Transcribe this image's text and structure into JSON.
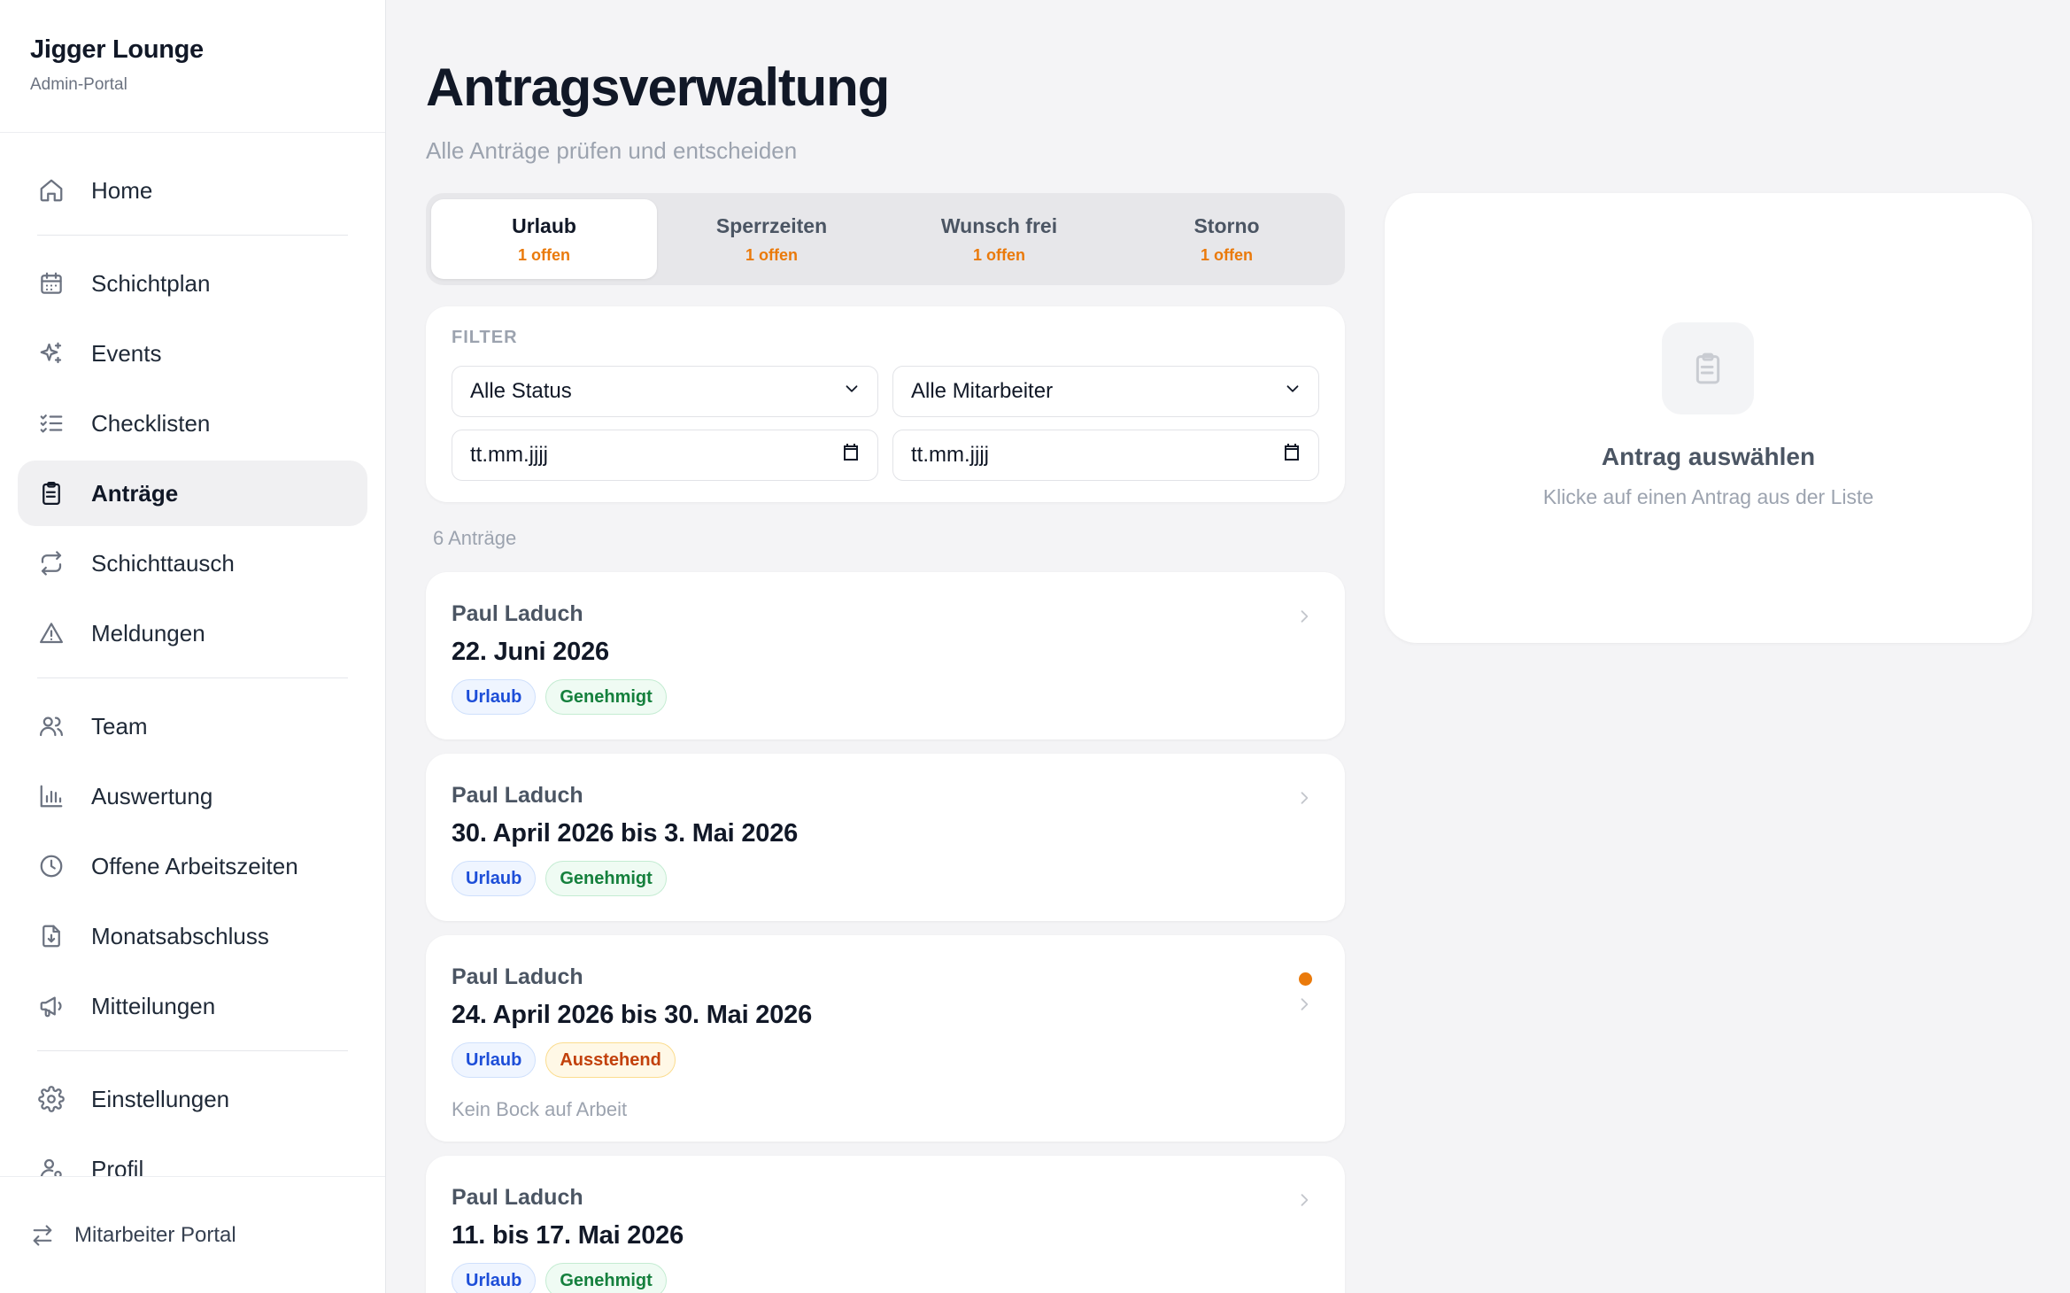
{
  "brand": {
    "name": "Jigger Lounge",
    "subtitle": "Admin-Portal"
  },
  "nav": {
    "home": "Home",
    "schichtplan": "Schichtplan",
    "events": "Events",
    "checklisten": "Checklisten",
    "antraege": "Anträge",
    "schichttausch": "Schichttausch",
    "meldungen": "Meldungen",
    "team": "Team",
    "auswertung": "Auswertung",
    "offene_arbeitszeiten": "Offene Arbeitszeiten",
    "monatsabschluss": "Monatsabschluss",
    "mitteilungen": "Mitteilungen",
    "einstellungen": "Einstellungen",
    "profil": "Profil",
    "active": "Anträge"
  },
  "footer": {
    "label": "Mitarbeiter Portal"
  },
  "page": {
    "title": "Antragsverwaltung",
    "subtitle": "Alle Anträge prüfen und entscheiden"
  },
  "tabs": [
    {
      "label": "Urlaub",
      "count": "1 offen",
      "active": true
    },
    {
      "label": "Sperrzeiten",
      "count": "1 offen",
      "active": false
    },
    {
      "label": "Wunsch frei",
      "count": "1 offen",
      "active": false
    },
    {
      "label": "Storno",
      "count": "1 offen",
      "active": false
    }
  ],
  "filter": {
    "title": "FILTER",
    "status_value": "Alle Status",
    "employee_value": "Alle Mitarbeiter",
    "date_from_placeholder": "tt.mm.jjjj",
    "date_to_placeholder": "tt.mm.jjjj"
  },
  "list": {
    "count_label": "6 Anträge",
    "items": [
      {
        "name": "Paul Laduch",
        "date": "22. Juni 2026",
        "type": "Urlaub",
        "status": "Genehmigt",
        "note": "",
        "unread": false
      },
      {
        "name": "Paul Laduch",
        "date": "30. April 2026 bis 3. Mai 2026",
        "type": "Urlaub",
        "status": "Genehmigt",
        "note": "",
        "unread": false
      },
      {
        "name": "Paul Laduch",
        "date": "24. April 2026 bis 30. Mai 2026",
        "type": "Urlaub",
        "status": "Ausstehend",
        "note": "Kein Bock auf Arbeit",
        "unread": true
      },
      {
        "name": "Paul Laduch",
        "date": "11. bis 17. Mai 2026",
        "type": "Urlaub",
        "status": "Genehmigt",
        "note": "",
        "unread": false
      }
    ]
  },
  "detail": {
    "title": "Antrag auswählen",
    "subtitle": "Klicke auf einen Antrag aus der Liste"
  },
  "colors": {
    "accent_orange": "#ea7a0b",
    "tag_blue": "#1d4ed8",
    "tag_green": "#15803d",
    "tag_amber": "#c2410c"
  }
}
